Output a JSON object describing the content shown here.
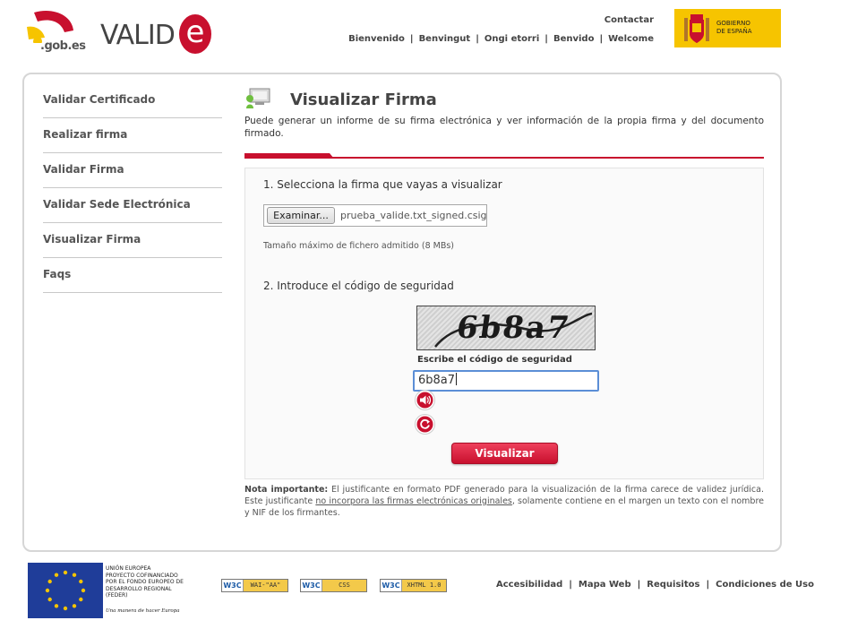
{
  "header": {
    "logo_gob_text": ".gob.es",
    "logo_valide_text": "VALID",
    "logo_valide_e": "e",
    "contact_label": "Contactar",
    "languages": [
      "Bienvenido",
      "Benvingut",
      "Ongi etorri",
      "Benvido",
      "Welcome"
    ],
    "gobierno_label_1": "GOBIERNO",
    "gobierno_label_2": "DE ESPAÑA"
  },
  "sidebar": {
    "items": [
      {
        "label": "Validar Certificado"
      },
      {
        "label": "Realizar firma"
      },
      {
        "label": "Validar Firma"
      },
      {
        "label": "Validar Sede Electrónica"
      },
      {
        "label": "Visualizar Firma"
      },
      {
        "label": "Faqs"
      }
    ]
  },
  "main": {
    "title": "Visualizar Firma",
    "intro": "Puede generar un informe de su firma electrónica y ver información de la propia firma y del documento firmado.",
    "step1_label": "1. Selecciona la firma que vayas a visualizar",
    "file_button_label": "Examinar...",
    "file_name": "prueba_valide.txt_signed.csig",
    "max_size_hint": "Tamaño máximo de fichero admitido (8 MBs)",
    "step2_label": "2. Introduce el código de seguridad",
    "captcha_image_text": "6b8a7",
    "captcha_label": "Escribe el código de seguridad",
    "captcha_value": "6b8a7",
    "submit_label": "Visualizar",
    "note_bold": "Nota importante:",
    "note_text_1": " El justificante en formato PDF generado para la visualización de la firma carece de validez jurídica. Este justificante ",
    "note_link": "no incorpora las firmas electrónicas originales",
    "note_text_2": ", solamente contiene en el margen un texto con el nombre y NIF de los firmantes."
  },
  "footer": {
    "eu_lines": [
      "UNIÓN EUROPEA",
      "PROYECTO COFINANCIADO",
      "POR EL FONDO EUROPEO DE",
      "DESARROLLO REGIONAL",
      "(FEDER)"
    ],
    "eu_tagline": "Una manera de hacer Europa",
    "badges": [
      {
        "w3c": "W3C",
        "label": "WAI-\"AA\""
      },
      {
        "w3c": "W3C",
        "label": "CSS"
      },
      {
        "w3c": "W3C",
        "label": "XHTML 1.0"
      }
    ],
    "links": [
      "Accesibilidad",
      "Mapa Web",
      "Requisitos",
      "Condiciones de Uso"
    ]
  },
  "colors": {
    "accent_red": "#c8102e",
    "gobierno_yellow": "#f6c400",
    "eu_blue": "#1f3d99",
    "focus_blue": "#5b8ed6"
  }
}
